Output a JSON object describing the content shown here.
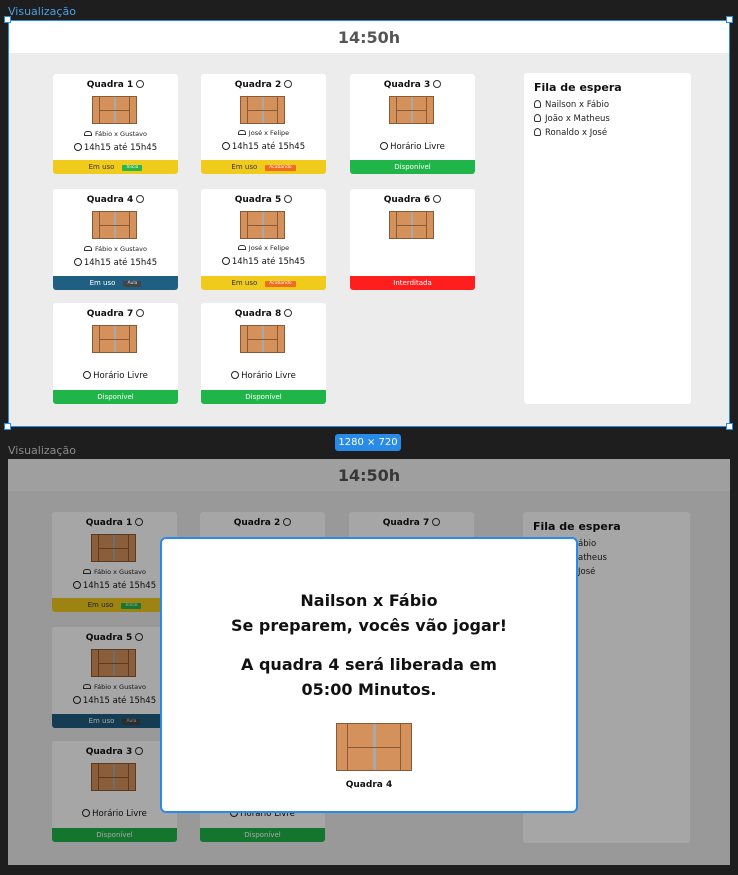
{
  "frames": {
    "top_label": "Visualização",
    "bottom_label": "Visualização",
    "size_badge": "1280 × 720"
  },
  "clock": "14:50h",
  "queue": {
    "title": "Fila de espera",
    "items": [
      "Nailson x Fábio",
      "João x  Matheus",
      "Ronaldo x José"
    ]
  },
  "courts": [
    {
      "title": "Quadra 1",
      "players": "Fábio x Gustavo",
      "time": "14h15 até 15h45",
      "status": "Em uso",
      "tag": "Início"
    },
    {
      "title": "Quadra 2",
      "players": "José x Felipe",
      "time": "14h15 até 15h45",
      "status": "Em uso",
      "tag": "Acabando"
    },
    {
      "title": "Quadra 3",
      "time": "Horário Livre",
      "status": "Disponível"
    },
    {
      "title": "Quadra 4",
      "players": "Fábio x Gustavo",
      "time": "14h15 até 15h45",
      "status": "Em uso",
      "tag": "Aula"
    },
    {
      "title": "Quadra 5",
      "players": "José x Felipe",
      "time": "14h15 até 15h45",
      "status": "Em uso",
      "tag": "Acabando"
    },
    {
      "title": "Quadra 6",
      "status": "Interditada"
    },
    {
      "title": "Quadra 7",
      "time": "Horário Livre",
      "status": "Disponível"
    },
    {
      "title": "Quadra 8",
      "time": "Horário Livre",
      "status": "Disponível"
    }
  ],
  "bottom_courts": [
    {
      "title": "Quadra 1",
      "players": "Fábio x Gustavo",
      "time": "14h15 até 15h45",
      "status": "Em uso",
      "tag": "Início"
    },
    {
      "title": "Quadra 5",
      "players": "Fábio x Gustavo",
      "time": "14h15 até 15h45",
      "status": "Em uso",
      "tag": "Aula"
    },
    {
      "title": "Quadra 3",
      "time": "Horário Livre",
      "status": "Disponível"
    },
    {
      "title": "Quadra 2"
    },
    {
      "title": "Quadra 7"
    },
    {
      "time": "Horário Livre",
      "status": "Disponível"
    }
  ],
  "bottom_queue_fragments": [
    "ábio",
    "atheus",
    "José"
  ],
  "modal": {
    "line1": "Nailson x Fábio",
    "line2": "Se preparem, vocês vão jogar!",
    "line3": "A quadra 4 será liberada em",
    "line4": "05:00 Minutos.",
    "court_label": "Quadra 4"
  }
}
